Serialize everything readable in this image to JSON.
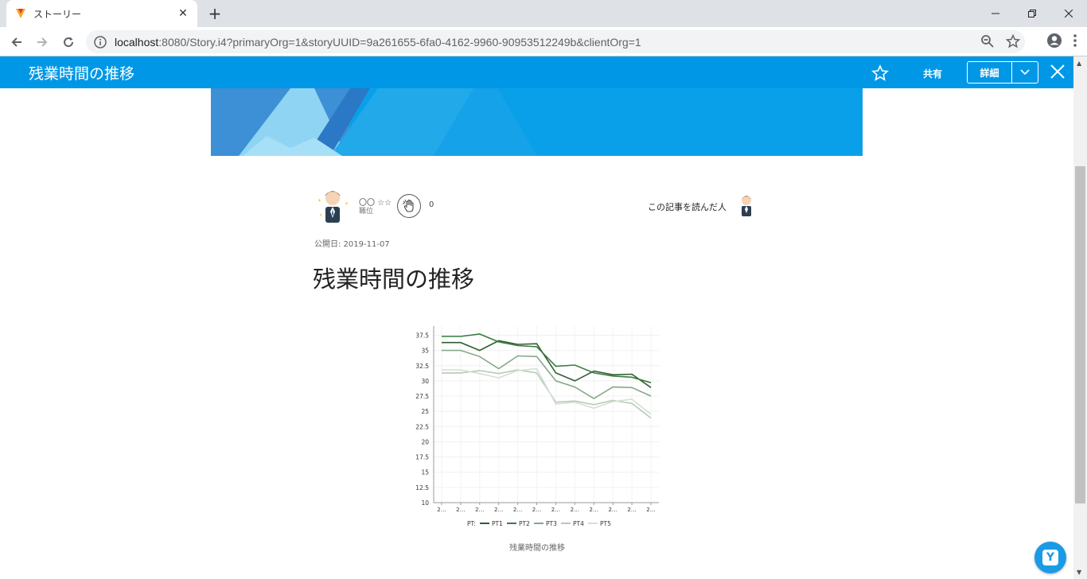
{
  "browser": {
    "tab_title": "ストーリー",
    "tab_close": "✕",
    "new_tab": "+",
    "url_host": "localhost",
    "url_rest": ":8080/Story.i4?primaryOrg=1&storyUUID=9a261655-6fa0-4162-9960-90953512249b&clientOrg=1"
  },
  "header": {
    "title": "残業時間の推移",
    "share_label": "共有",
    "detail_label": "詳細"
  },
  "author": {
    "name": "〇〇 ☆☆",
    "role": "職位",
    "like_count": "0",
    "readers_label": "この記事を読んだ人"
  },
  "article": {
    "published": "公開日: 2019-11-07",
    "title": "残業時間の推移",
    "caption": "残業時間の推移"
  },
  "colors": {
    "accent": "#0098e6",
    "pt1": "#2e5e33",
    "pt2": "#3c7a40",
    "pt3": "#86a98a",
    "pt4": "#b5ccb6",
    "pt5": "#d5dfd6"
  },
  "chart_data": {
    "type": "line",
    "title": "",
    "xlabel": "",
    "ylabel": "",
    "categories": [
      "2…",
      "2…",
      "2…",
      "2…",
      "2…",
      "2…",
      "2…",
      "2…",
      "2…",
      "2…",
      "2…",
      "2…"
    ],
    "ylim": [
      10,
      39
    ],
    "yticks": [
      10,
      12.5,
      15,
      17.5,
      20,
      22.5,
      25,
      27.5,
      30,
      32.5,
      35,
      37.5
    ],
    "legend_title": "PT:",
    "legend_position": "bottom",
    "grid": true,
    "series": [
      {
        "name": "PT1",
        "values": [
          36.3,
          36.3,
          35.0,
          36.6,
          36.0,
          36.1,
          31.3,
          30.0,
          31.6,
          31.0,
          31.1,
          28.9
        ]
      },
      {
        "name": "PT2",
        "values": [
          37.3,
          37.3,
          37.7,
          36.4,
          35.8,
          35.6,
          32.4,
          32.6,
          31.3,
          30.8,
          30.6,
          29.7
        ]
      },
      {
        "name": "PT3",
        "values": [
          35.0,
          35.0,
          34.0,
          32.0,
          34.1,
          34.0,
          30.0,
          29.0,
          27.1,
          29.0,
          28.9,
          27.5
        ]
      },
      {
        "name": "PT4",
        "values": [
          31.3,
          31.3,
          31.7,
          31.2,
          31.8,
          31.3,
          26.5,
          26.7,
          26.1,
          26.8,
          26.3,
          23.9
        ]
      },
      {
        "name": "PT5",
        "values": [
          31.8,
          31.8,
          31.2,
          30.5,
          31.7,
          32.0,
          26.2,
          26.5,
          25.5,
          26.6,
          27.0,
          24.5
        ]
      }
    ]
  }
}
